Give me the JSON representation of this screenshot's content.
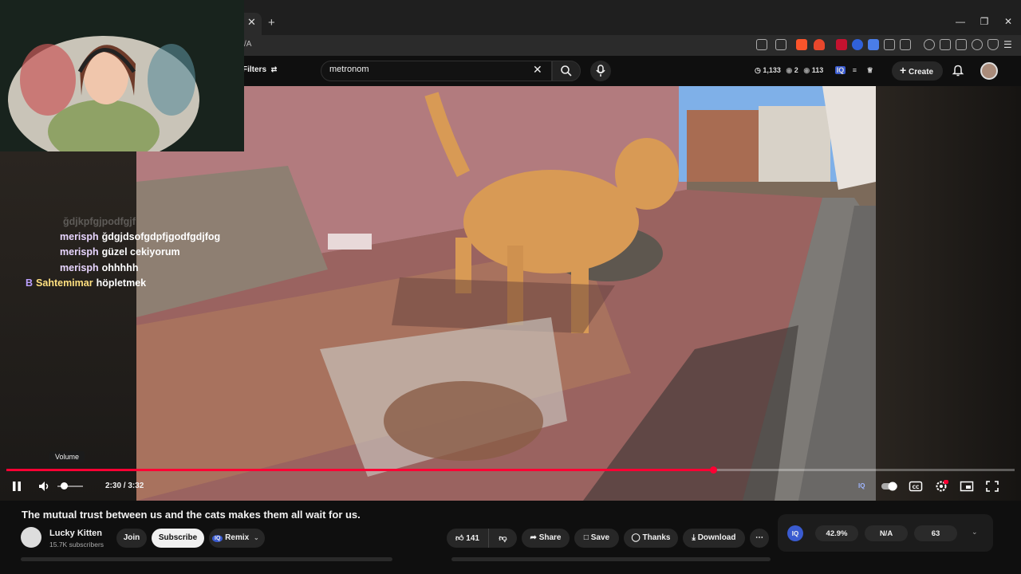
{
  "browser": {
    "address": "/A",
    "tab_close": "✕",
    "new_tab": "+"
  },
  "header": {
    "filters_label": "Filters",
    "search_value": "metronom",
    "stats": {
      "views": "1,133",
      "watching": "2",
      "seen": "113"
    },
    "create_label": "Create"
  },
  "chat": {
    "faded_line": "ğdjkpfgjpodfgjf",
    "lines": [
      {
        "user": "merisph",
        "message": "ğdgjdsofgdpfjgodfgdjfog"
      },
      {
        "user": "merisph",
        "message": "güzel cekiyorum"
      },
      {
        "user": "merisph",
        "message": "ohhhhh"
      },
      {
        "badge": "B",
        "user": "Sahtemimar",
        "message": "höpletmek"
      }
    ]
  },
  "player": {
    "volume_tooltip": "Volume",
    "time_display": "2:30 / 3:32",
    "progress_fraction": 0.701,
    "volume_fraction": 0.25,
    "accent": "#ff0033"
  },
  "video_meta": {
    "title": "The mutual trust between us and the cats makes them all wait for us.",
    "channel_name": "Lucky Kitten",
    "subscribers": "15.7K subscribers",
    "join_label": "Join",
    "subscribe_label": "Subscribe",
    "remix_label": "Remix",
    "like_count": "141",
    "share_label": "Share",
    "save_label": "Save",
    "thanks_label": "Thanks",
    "download_label": "Download"
  },
  "iq_panel": {
    "badge": "IQ",
    "values": [
      "42.9%",
      "N/A",
      "63"
    ]
  },
  "icons": [
    "tab-close-icon",
    "new-tab-icon",
    "filters-icon",
    "clear-icon",
    "search-icon",
    "mic-icon",
    "clock-icon",
    "eye-icon",
    "plus-icon",
    "bell-icon",
    "pause-icon",
    "volume-icon",
    "iq-icon",
    "autoplay-toggle-icon",
    "captions-icon",
    "settings-icon",
    "miniplayer-icon",
    "fullscreen-icon",
    "like-icon",
    "dislike-icon",
    "share-icon",
    "bookmark-icon",
    "thanks-icon",
    "download-icon",
    "more-icon",
    "chevron-down-icon"
  ]
}
